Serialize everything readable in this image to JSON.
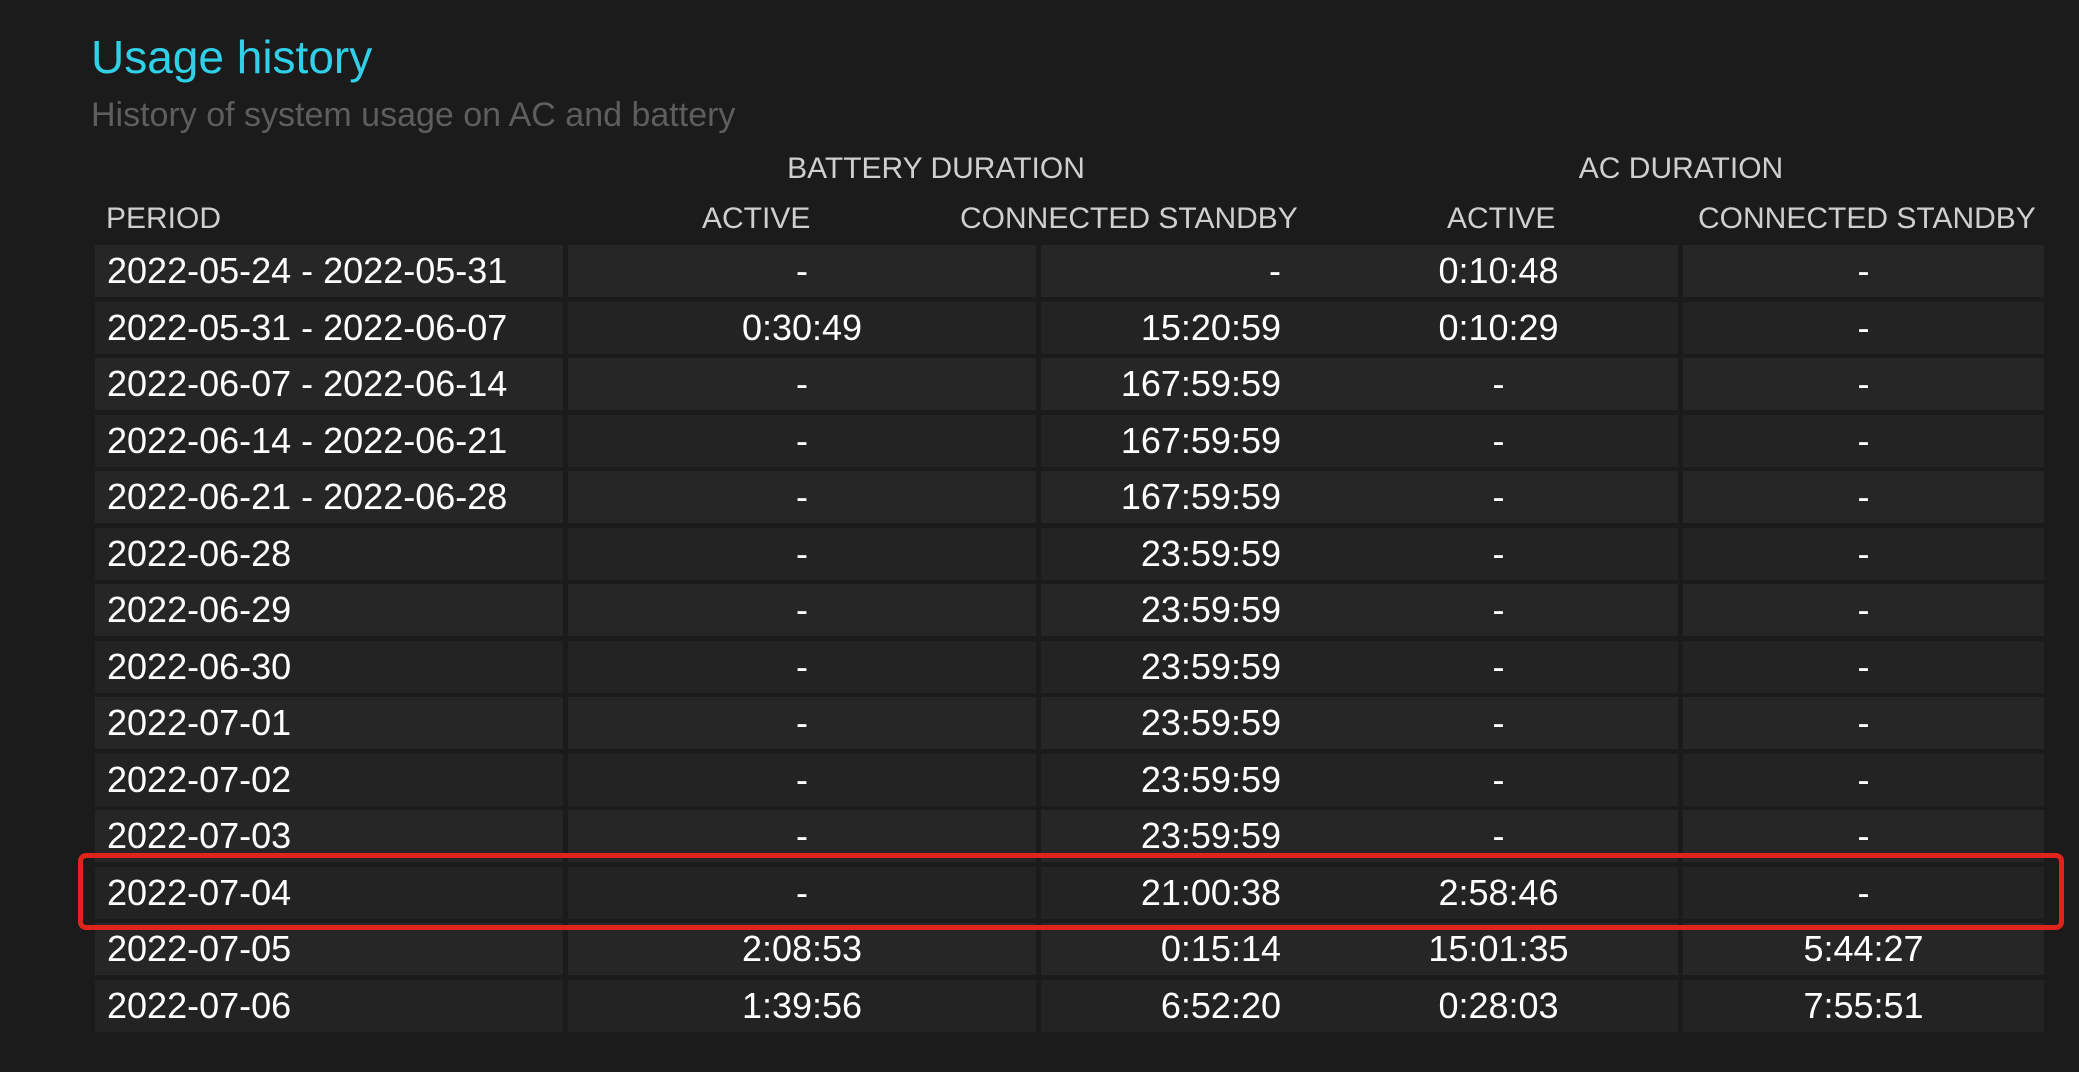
{
  "header": {
    "title": "Usage history",
    "subtitle": "History of system usage on AC and battery"
  },
  "table": {
    "group_headers": {
      "battery": "BATTERY DURATION",
      "ac": "AC DURATION"
    },
    "columns": {
      "period": "PERIOD",
      "battery_active": "ACTIVE",
      "battery_connected_standby": "CONNECTED STANDBY",
      "ac_active": "ACTIVE",
      "ac_connected_standby": "CONNECTED STANDBY"
    },
    "rows": [
      {
        "period": "2022-05-24 - 2022-05-31",
        "battery_active": "-",
        "battery_cs": "-",
        "ac_active": "0:10:48",
        "ac_cs": "-"
      },
      {
        "period": "2022-05-31 - 2022-06-07",
        "battery_active": "0:30:49",
        "battery_cs": "15:20:59",
        "ac_active": "0:10:29",
        "ac_cs": "-"
      },
      {
        "period": "2022-06-07 - 2022-06-14",
        "battery_active": "-",
        "battery_cs": "167:59:59",
        "ac_active": "-",
        "ac_cs": "-"
      },
      {
        "period": "2022-06-14 - 2022-06-21",
        "battery_active": "-",
        "battery_cs": "167:59:59",
        "ac_active": "-",
        "ac_cs": "-"
      },
      {
        "period": "2022-06-21 - 2022-06-28",
        "battery_active": "-",
        "battery_cs": "167:59:59",
        "ac_active": "-",
        "ac_cs": "-"
      },
      {
        "period": "2022-06-28",
        "battery_active": "-",
        "battery_cs": "23:59:59",
        "ac_active": "-",
        "ac_cs": "-"
      },
      {
        "period": "2022-06-29",
        "battery_active": "-",
        "battery_cs": "23:59:59",
        "ac_active": "-",
        "ac_cs": "-"
      },
      {
        "period": "2022-06-30",
        "battery_active": "-",
        "battery_cs": "23:59:59",
        "ac_active": "-",
        "ac_cs": "-"
      },
      {
        "period": "2022-07-01",
        "battery_active": "-",
        "battery_cs": "23:59:59",
        "ac_active": "-",
        "ac_cs": "-"
      },
      {
        "period": "2022-07-02",
        "battery_active": "-",
        "battery_cs": "23:59:59",
        "ac_active": "-",
        "ac_cs": "-"
      },
      {
        "period": "2022-07-03",
        "battery_active": "-",
        "battery_cs": "23:59:59",
        "ac_active": "-",
        "ac_cs": "-"
      },
      {
        "period": "2022-07-04",
        "battery_active": "-",
        "battery_cs": "21:00:38",
        "ac_active": "2:58:46",
        "ac_cs": "-"
      },
      {
        "period": "2022-07-05",
        "battery_active": "2:08:53",
        "battery_cs": "0:15:14",
        "ac_active": "15:01:35",
        "ac_cs": "5:44:27"
      },
      {
        "period": "2022-07-06",
        "battery_active": "1:39:56",
        "battery_cs": "6:52:20",
        "ac_active": "0:28:03",
        "ac_cs": "7:55:51"
      }
    ]
  },
  "colors": {
    "background": "#1b1b1b",
    "title": "#2fd0e8",
    "highlight": "#e0241c"
  }
}
